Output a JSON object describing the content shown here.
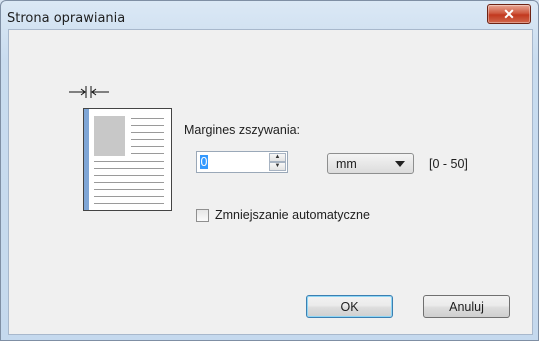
{
  "dialog": {
    "title": "Strona oprawiania",
    "close_glyph": "✕"
  },
  "illustration": {
    "icon": "binding-margin-arrows-icon"
  },
  "margin": {
    "label": "Margines zszywania:",
    "value": "0",
    "spin_up": "▲",
    "spin_down": "▼",
    "unit": "mm",
    "range": "[0 - 50]"
  },
  "auto_reduce": {
    "label": "Zmniejszanie automatyczne",
    "checked": false
  },
  "buttons": {
    "ok": "OK",
    "cancel": "Anuluj"
  }
}
